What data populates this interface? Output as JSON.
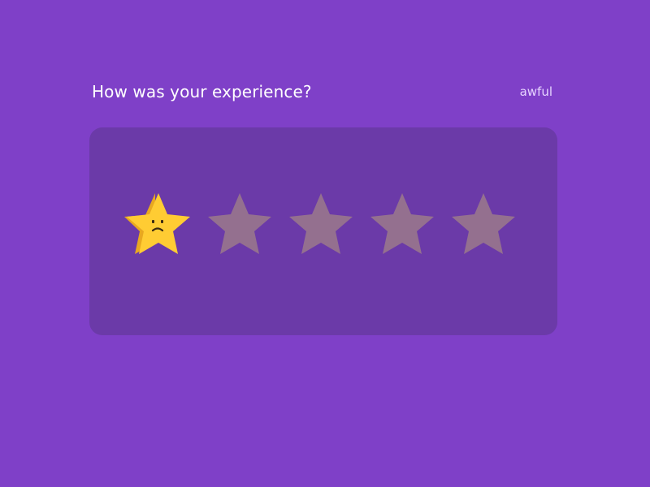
{
  "rating": {
    "question": "How was your experience?",
    "label": "awful",
    "value": 1,
    "max": 5
  },
  "colors": {
    "background": "#7f40c8",
    "card": "#6b3aa8",
    "star_active": "#ffcc33",
    "star_active_side": "#e8a820",
    "star_inactive": "#94708f",
    "face": "#3a2a12"
  },
  "icons": {
    "star": "star-icon",
    "face": "sad-face-icon"
  }
}
